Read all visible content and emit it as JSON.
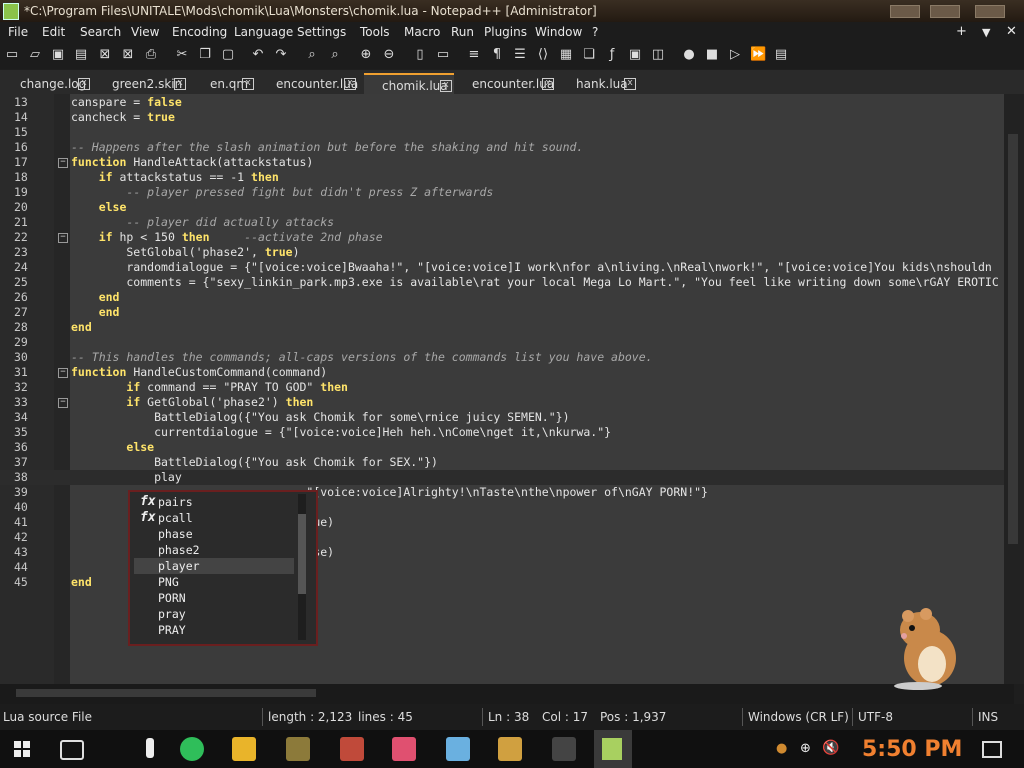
{
  "window": {
    "title": "*C:\\Program Files\\UNITALE\\Mods\\chomik\\Lua\\Monsters\\chomik.lua - Notepad++ [Administrator]"
  },
  "menu": {
    "items": [
      "File",
      "Edit",
      "Search",
      "View",
      "Encoding",
      "Language",
      "Settings",
      "Tools",
      "Macro",
      "Run",
      "Plugins",
      "Window",
      "?"
    ],
    "plus": "+",
    "down": "▼",
    "close": "✕"
  },
  "tabs": [
    {
      "label": "change.log",
      "close": "x"
    },
    {
      "label": "green2.skin",
      "close": "x"
    },
    {
      "label": "en.qm",
      "close": "x"
    },
    {
      "label": "encounter.lua",
      "close": "x"
    },
    {
      "label": "chomik.lua",
      "close": "x",
      "active": true
    },
    {
      "label": "encounter.lua",
      "close": "x"
    },
    {
      "label": "hank.lua",
      "close": "x"
    }
  ],
  "lines": [
    {
      "n": "13",
      "code": "canspare = false"
    },
    {
      "n": "14",
      "code": "cancheck = true"
    },
    {
      "n": "15",
      "code": ""
    },
    {
      "n": "16",
      "code": "-- Happens after the slash animation but before the shaking and hit sound."
    },
    {
      "n": "17",
      "code": "function HandleAttack(attackstatus)"
    },
    {
      "n": "18",
      "code": "    if attackstatus == -1 then"
    },
    {
      "n": "19",
      "code": "        -- player pressed fight but didn't press Z afterwards"
    },
    {
      "n": "20",
      "code": "    else"
    },
    {
      "n": "21",
      "code": "        -- player did actually attacks"
    },
    {
      "n": "22",
      "code": "    if hp < 150 then     --activate 2nd phase"
    },
    {
      "n": "23",
      "code": "        SetGlobal('phase2', true)"
    },
    {
      "n": "24",
      "code": "        randomdialogue = {\"[voice:voice]Bwaaha!\", \"[voice:voice]I work\\nfor a\\nliving.\\nReal\\nwork!\", \"[voice:voice]You kids\\nshouldn"
    },
    {
      "n": "25",
      "code": "        comments = {\"sexy_linkin_park.mp3.exe is available\\rat your local Mega Lo Mart.\", \"You feel like writing down some\\rGAY EROTIC"
    },
    {
      "n": "26",
      "code": "    end"
    },
    {
      "n": "27",
      "code": "    end"
    },
    {
      "n": "28",
      "code": "end"
    },
    {
      "n": "29",
      "code": ""
    },
    {
      "n": "30",
      "code": "-- This handles the commands; all-caps versions of the commands list you have above."
    },
    {
      "n": "31",
      "code": "function HandleCustomCommand(command)"
    },
    {
      "n": "32",
      "code": "        if command == \"PRAY TO GOD\" then"
    },
    {
      "n": "33",
      "code": "        if GetGlobal('phase2') then"
    },
    {
      "n": "34",
      "code": "            BattleDialog({\"You ask Chomik for some\\rnice juicy SEMEN.\"})"
    },
    {
      "n": "35",
      "code": "            currentdialogue = {\"[voice:voice]Heh heh.\\nCome\\nget it,\\nkurwa.\"}"
    },
    {
      "n": "36",
      "code": "        else"
    },
    {
      "n": "37",
      "code": "            BattleDialog({\"You ask Chomik for SEX.\"})"
    },
    {
      "n": "38",
      "code": "            play"
    },
    {
      "n": "39",
      "code": "                                  \"[voice:voice]Alrighty!\\nTaste\\nthe\\npower of\\nGAY PORN!\"}"
    },
    {
      "n": "40",
      "code": ""
    },
    {
      "n": "41",
      "code": "                                  rue)"
    },
    {
      "n": "42",
      "code": ""
    },
    {
      "n": "43",
      "code": "                                  lse)"
    },
    {
      "n": "44",
      "code": ""
    },
    {
      "n": "45",
      "code": "end"
    }
  ],
  "autocomplete": [
    {
      "label": "pairs",
      "icon": "fx"
    },
    {
      "label": "pcall",
      "icon": "fx"
    },
    {
      "label": "phase",
      "icon": ""
    },
    {
      "label": "phase2",
      "icon": ""
    },
    {
      "label": "player",
      "icon": "",
      "selected": true
    },
    {
      "label": "PNG",
      "icon": ""
    },
    {
      "label": "PORN",
      "icon": ""
    },
    {
      "label": "pray",
      "icon": ""
    },
    {
      "label": "PRAY",
      "icon": ""
    }
  ],
  "status": {
    "filetype": "Lua source File",
    "length": "length : 2,123",
    "lines": "lines : 45",
    "ln": "Ln : 38",
    "col": "Col : 17",
    "pos": "Pos : 1,937",
    "eol": "Windows (CR LF)",
    "encoding": "UTF-8",
    "mode": "INS"
  },
  "taskbar": {
    "clock": "5:50 PM"
  }
}
